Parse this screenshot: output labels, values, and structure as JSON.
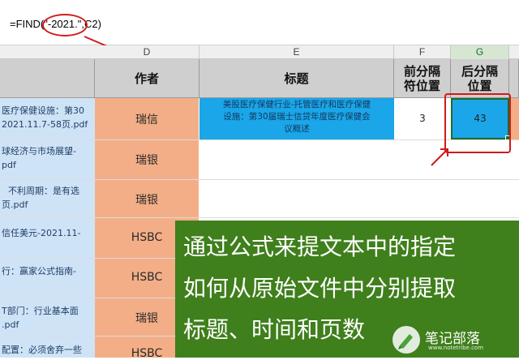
{
  "formula_bar": {
    "formula": "=FIND(\"-2021.\",C2)"
  },
  "columns": {
    "D": "D",
    "E": "E",
    "F": "F",
    "G": "G"
  },
  "header": {
    "author": "作者",
    "title": "标题",
    "front_sep_line1": "前分隔",
    "front_sep_line2": "符位置",
    "back_sep_line1": "后分隔",
    "back_sep_line2": "位置"
  },
  "column_c_rows": [
    "医疗保健设施：第30",
    "2021.11.7-58页.pdf",
    "球经济与市场展望-",
    "pdf",
    "不利周期：是有选",
    "页.pdf",
    "信任美元-2021.11-",
    "行：赢家公式指南-",
    "T部门：行业基本面",
    ".pdf",
    "配置：必须舍弃一些"
  ],
  "authors": [
    "瑞信",
    "瑞银",
    "瑞银",
    "HSBC",
    "HSBC",
    "瑞银",
    "HSBC"
  ],
  "row1": {
    "title_line1": "美股医疗保健行业-托管医疗和医疗保健",
    "title_line2": "设施：第30届瑞士信贷年度医疗保健会",
    "title_line3": "议概述",
    "front_pos": "3",
    "back_pos": "43"
  },
  "caption": {
    "line1": "通过公式来提文本中的指定",
    "line2": "如何从原始文件中分别提取",
    "line3": "标题、时间和页数"
  },
  "watermark": {
    "name": "笔记部落",
    "url": "www.notetribe.com"
  },
  "colors": {
    "highlight_blue": "#1aa6e8",
    "author_orange": "#f3ae87",
    "caption_green": "#3f7f1c",
    "annotation_red": "#d21a1a"
  }
}
